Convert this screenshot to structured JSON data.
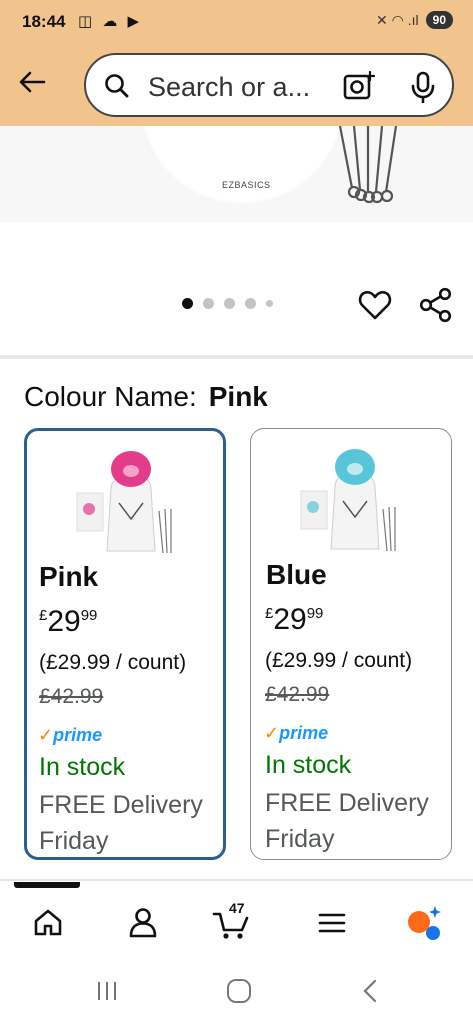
{
  "status_bar": {
    "time": "18:44",
    "left_icons": "◫ ☁ ▶",
    "right_icons": "✕ ◠ .ıl",
    "battery": "90"
  },
  "header": {
    "search_placeholder": "Search or a..."
  },
  "product_image": {
    "brand": "EZBASICS",
    "carousel": {
      "count": 5,
      "active_index": 0
    }
  },
  "variants": {
    "label": "Colour Name:",
    "selected_value": "Pink",
    "options": [
      {
        "name": "Pink",
        "currency": "£",
        "price_whole": "29",
        "price_fraction": "99",
        "unit_price": "(£29.99 / count)",
        "was_price": "£42.99",
        "prime": "prime",
        "stock": "In stock",
        "delivery": "FREE Delivery",
        "delivery_day": "Friday",
        "accent": "#e23c8a"
      },
      {
        "name": "Blue",
        "currency": "£",
        "price_whole": "29",
        "price_fraction": "99",
        "unit_price": "(£29.99 / count)",
        "was_price": "£42.99",
        "prime": "prime",
        "stock": "In stock",
        "delivery": "FREE Delivery",
        "delivery_day": "Friday",
        "accent": "#58c6d8"
      }
    ]
  },
  "bottom_nav": {
    "cart_count": "47",
    "items": [
      "home-icon",
      "account-icon",
      "cart-icon",
      "menu-icon",
      "rufus-assistant-icon"
    ]
  },
  "colors": {
    "header_bg": "#f2c48d",
    "selected_border": "#2b5f8f",
    "in_stock": "#007600",
    "prime_blue": "#1a98ff",
    "assistant_orange": "#ff6a1a",
    "assistant_blue": "#1a73e8"
  }
}
